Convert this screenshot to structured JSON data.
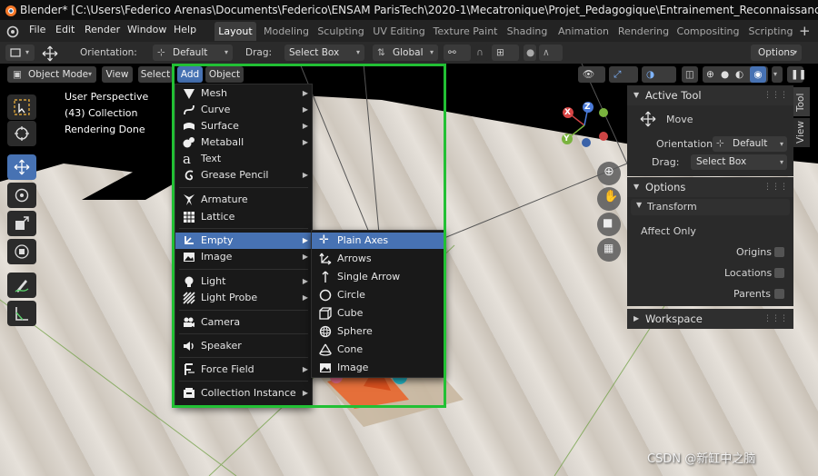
{
  "window": {
    "title": "Blender* [C:\\Users\\Federico Arenas\\Documents\\Federico\\ENSAM ParisTech\\2020-1\\Mecatronique\\Projet_Pedagogique\\Entrainement_Reconnaissance _dImgae\\Detection_objets\\Blender"
  },
  "top_menu": [
    "File",
    "Edit",
    "Render",
    "Window",
    "Help"
  ],
  "workspace_tabs": [
    "Layout",
    "Modeling",
    "Sculpting",
    "UV Editing",
    "Texture Paint",
    "Shading",
    "Animation",
    "Rendering",
    "Compositing",
    "Scripting"
  ],
  "workspace_active": "Layout",
  "tool_header": {
    "orientation_label": "Orientation:",
    "orientation_value": "Default",
    "drag_label": "Drag:",
    "drag_value": "Select Box",
    "transform_orientation": "Global",
    "options": "Options"
  },
  "viewport_header": {
    "mode": "Object Mode",
    "menus": [
      "View",
      "Select",
      "Add",
      "Object"
    ],
    "active_menu": "Add"
  },
  "overlay_text": {
    "perspective": "User Perspective",
    "collection": "(43) Collection",
    "status": "Rendering Done"
  },
  "gizmo": {
    "x": "X",
    "y": "Y",
    "z": "Z"
  },
  "add_menu": [
    {
      "label": "Mesh",
      "icon": "mesh-icon",
      "submenu": true
    },
    {
      "label": "Curve",
      "icon": "curve-icon",
      "submenu": true
    },
    {
      "label": "Surface",
      "icon": "surface-icon",
      "submenu": true
    },
    {
      "label": "Metaball",
      "icon": "metaball-icon",
      "submenu": true
    },
    {
      "label": "Text",
      "icon": "text-icon",
      "submenu": false
    },
    {
      "label": "Grease Pencil",
      "icon": "grease-pencil-icon",
      "submenu": true
    },
    {
      "label": "Armature",
      "icon": "armature-icon",
      "submenu": false
    },
    {
      "label": "Lattice",
      "icon": "lattice-icon",
      "submenu": false
    },
    {
      "label": "Empty",
      "icon": "empty-icon",
      "submenu": true
    },
    {
      "label": "Image",
      "icon": "image-icon",
      "submenu": true
    },
    {
      "label": "Light",
      "icon": "light-icon",
      "submenu": true
    },
    {
      "label": "Light Probe",
      "icon": "light-probe-icon",
      "submenu": true
    },
    {
      "label": "Camera",
      "icon": "camera-icon",
      "submenu": false
    },
    {
      "label": "Speaker",
      "icon": "speaker-icon",
      "submenu": false
    },
    {
      "label": "Force Field",
      "icon": "force-field-icon",
      "submenu": true
    },
    {
      "label": "Collection Instance",
      "icon": "collection-instance-icon",
      "submenu": true
    }
  ],
  "empty_submenu": [
    "Plain Axes",
    "Arrows",
    "Single Arrow",
    "Circle",
    "Cube",
    "Sphere",
    "Cone",
    "Image"
  ],
  "sidebar": {
    "active_tool_title": "Active Tool",
    "tool_name": "Move",
    "orientation_label": "Orientation",
    "orientation_value": "Default",
    "drag_label": "Drag:",
    "drag_value": "Select Box",
    "options_title": "Options",
    "transform_title": "Transform",
    "affect_only": "Affect Only",
    "origins": "Origins",
    "locations": "Locations",
    "parents": "Parents",
    "workspace_title": "Workspace",
    "tabs": [
      "Tool",
      "View"
    ]
  },
  "watermark": "CSDN @新缸中之脑",
  "colors": {
    "accent": "#4772b3",
    "highlight_box": "#22c034"
  }
}
